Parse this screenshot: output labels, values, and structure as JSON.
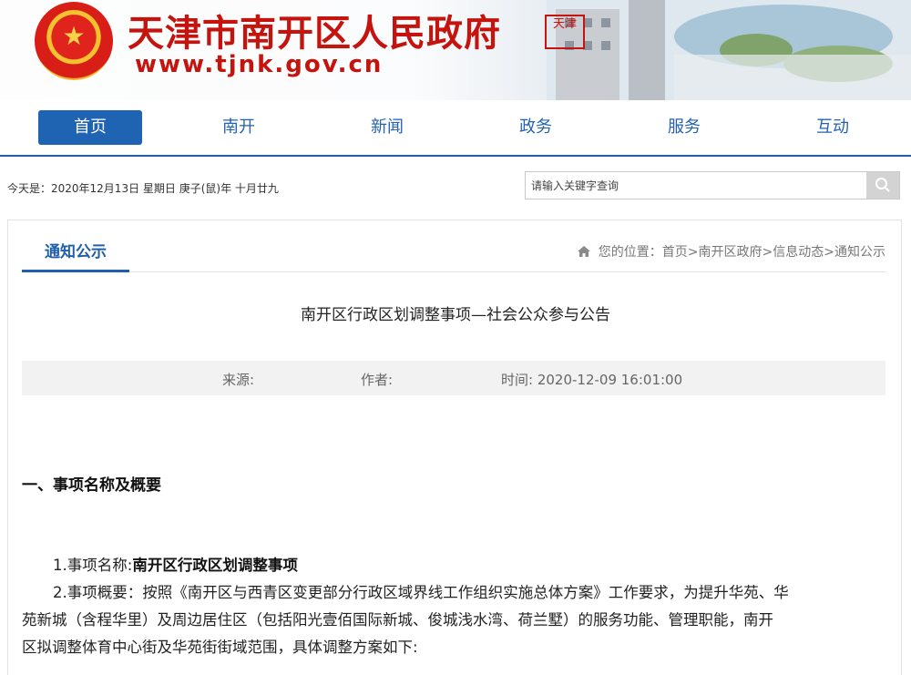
{
  "header": {
    "title": "天津市南开区人民政府",
    "url": "www.tjnk.gov.cn",
    "seal_text": "天津"
  },
  "nav": {
    "items": [
      {
        "label": "首页",
        "active": true
      },
      {
        "label": "南开",
        "active": false
      },
      {
        "label": "新闻",
        "active": false
      },
      {
        "label": "政务",
        "active": false
      },
      {
        "label": "服务",
        "active": false
      },
      {
        "label": "互动",
        "active": false
      }
    ]
  },
  "topbar": {
    "today": "今天是：2020年12月13日  星期日   庚子(鼠)年 十月廿九",
    "search_placeholder": "请输入关键字查询"
  },
  "panel": {
    "tab": "通知公示",
    "breadcrumb": "您的位置：首页>南开区政府>信息动态>通知公示"
  },
  "article": {
    "title": "南开区行政区划调整事项—社会公众参与公告",
    "source_label": "来源:",
    "author_label": "作者:",
    "time_label": "时间: 2020-12-09 16:01:00",
    "section1_heading": "一、事项名称及概要",
    "item1_prefix": "1.事项名称:",
    "item1_value": "南开区行政区划调整事项",
    "item2_line1": "2.事项概要：按照《南开区与西青区变更部分行政区域界线工作组织实施总体方案》工作要求，为提升华苑、华",
    "item2_line2": "苑新城（含程华里）及周边居住区（包括阳光壹佰国际新城、俊城浅水湾、荷兰墅）的服务功能、管理职能，南开",
    "item2_line3": "区拟调整体育中心街及华苑街街域范围，具体调整方案如下:"
  },
  "colors": {
    "brand_red": "#c5140d",
    "nav_blue": "#1f63b3"
  }
}
